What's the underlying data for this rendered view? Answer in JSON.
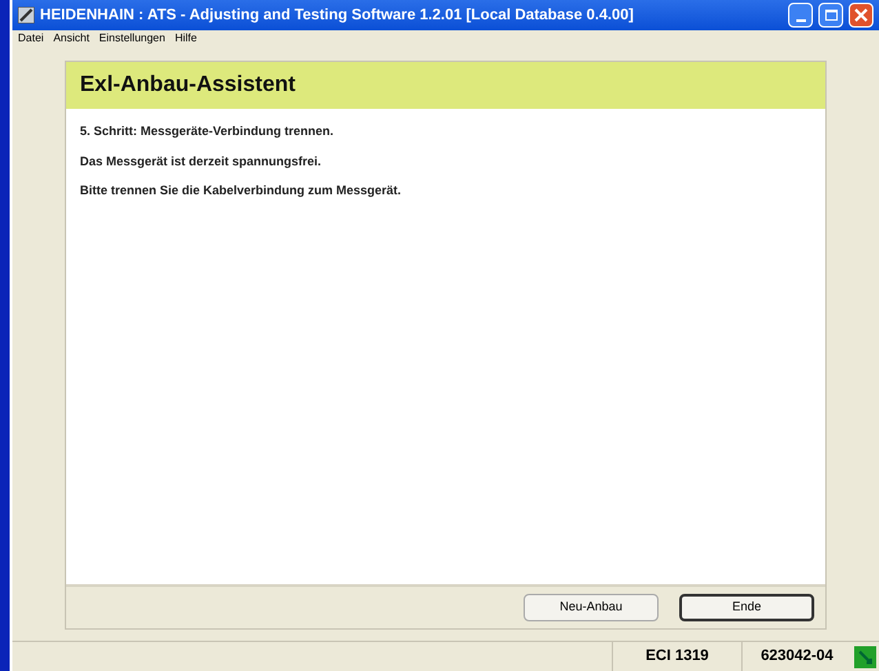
{
  "window": {
    "title": "HEIDENHAIN : ATS - Adjusting and Testing Software 1.2.01 [Local Database 0.4.00]"
  },
  "menu": [
    "Datei",
    "Ansicht",
    "Einstellungen",
    "Hilfe"
  ],
  "wizard": {
    "title": "Exl-Anbau-Assistent",
    "lines": [
      "5. Schritt: Messgeräte-Verbindung trennen.",
      "Das Messgerät ist derzeit spannungsfrei.",
      "Bitte trennen Sie die Kabelverbindung zum Messgerät."
    ],
    "buttons": [
      {
        "label": "Neu-Anbau",
        "default": false
      },
      {
        "label": "Ende",
        "default": true
      }
    ]
  },
  "status_bar": [
    "ECI 1319",
    "623042-04"
  ]
}
